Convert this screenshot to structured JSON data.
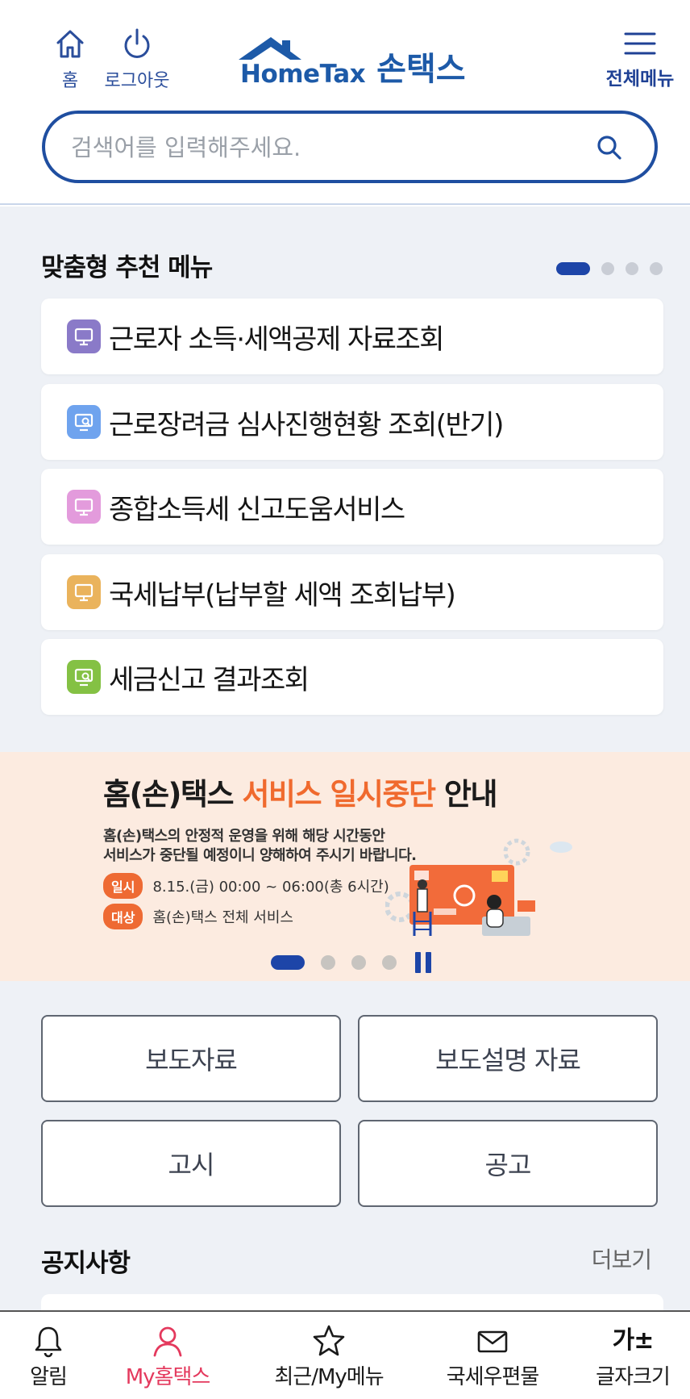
{
  "header": {
    "home_label": "홈",
    "logout_label": "로그아웃",
    "logo_text": "HomeTax",
    "logo_korean": "손택스",
    "menu_label": "전체메뉴"
  },
  "search": {
    "placeholder": "검색어를 입력해주세요."
  },
  "recommended": {
    "title": "맞춤형 추천 메뉴",
    "page_count": 4,
    "active_page": 1,
    "items": [
      {
        "label": "근로자 소득·세액공제 자료조회",
        "icon": "monitor-icon",
        "color": "#8a7ac8"
      },
      {
        "label": "근로장려금 심사진행현황 조회(반기)",
        "icon": "monitor-search-icon",
        "color": "#6fa3ee"
      },
      {
        "label": "종합소득세 신고도움서비스",
        "icon": "monitor-icon",
        "color": "#e39bdc"
      },
      {
        "label": "국세납부(납부할 세액 조회납부)",
        "icon": "monitor-icon",
        "color": "#eab35c"
      },
      {
        "label": "세금신고 결과조회",
        "icon": "monitor-check-icon",
        "color": "#84c144"
      }
    ]
  },
  "banner": {
    "title_pre": "홈(손)택스 ",
    "title_highlight": "서비스 일시중단",
    "title_post": " 안내",
    "desc_line1": "홈(손)택스의 안정적 운영을 위해 해당 시간동안",
    "desc_line2": "서비스가 중단될 예정이니 양해하여 주시기 바랍니다.",
    "date_pill": "일시",
    "date_text": "8.15.(금) 00:00 ~ 06:00(총 6시간)",
    "target_pill": "대상",
    "target_text": "홈(손)택스 전체 서비스",
    "slide_count": 4,
    "active_slide": 1,
    "accent_color": "#f06a2e"
  },
  "links": {
    "press_release": "보도자료",
    "press_explanation": "보도설명 자료",
    "notification": "고시",
    "announcement": "공고"
  },
  "notices": {
    "title": "공지사항",
    "more_label": "더보기"
  },
  "bottom_nav": {
    "items": [
      {
        "label": "알림",
        "icon": "bell-icon"
      },
      {
        "label": "My홈택스",
        "icon": "person-icon",
        "active": true
      },
      {
        "label": "최근/My메뉴",
        "icon": "star-icon"
      },
      {
        "label": "국세우편물",
        "icon": "envelope-icon"
      },
      {
        "label": "글자크기",
        "icon": "font-size-icon",
        "glyph": "가±"
      }
    ],
    "active_color": "#e4395d"
  },
  "colors": {
    "brand": "#1d5aa8",
    "accent": "#1d45a8",
    "section_bg": "#eef1f6"
  }
}
